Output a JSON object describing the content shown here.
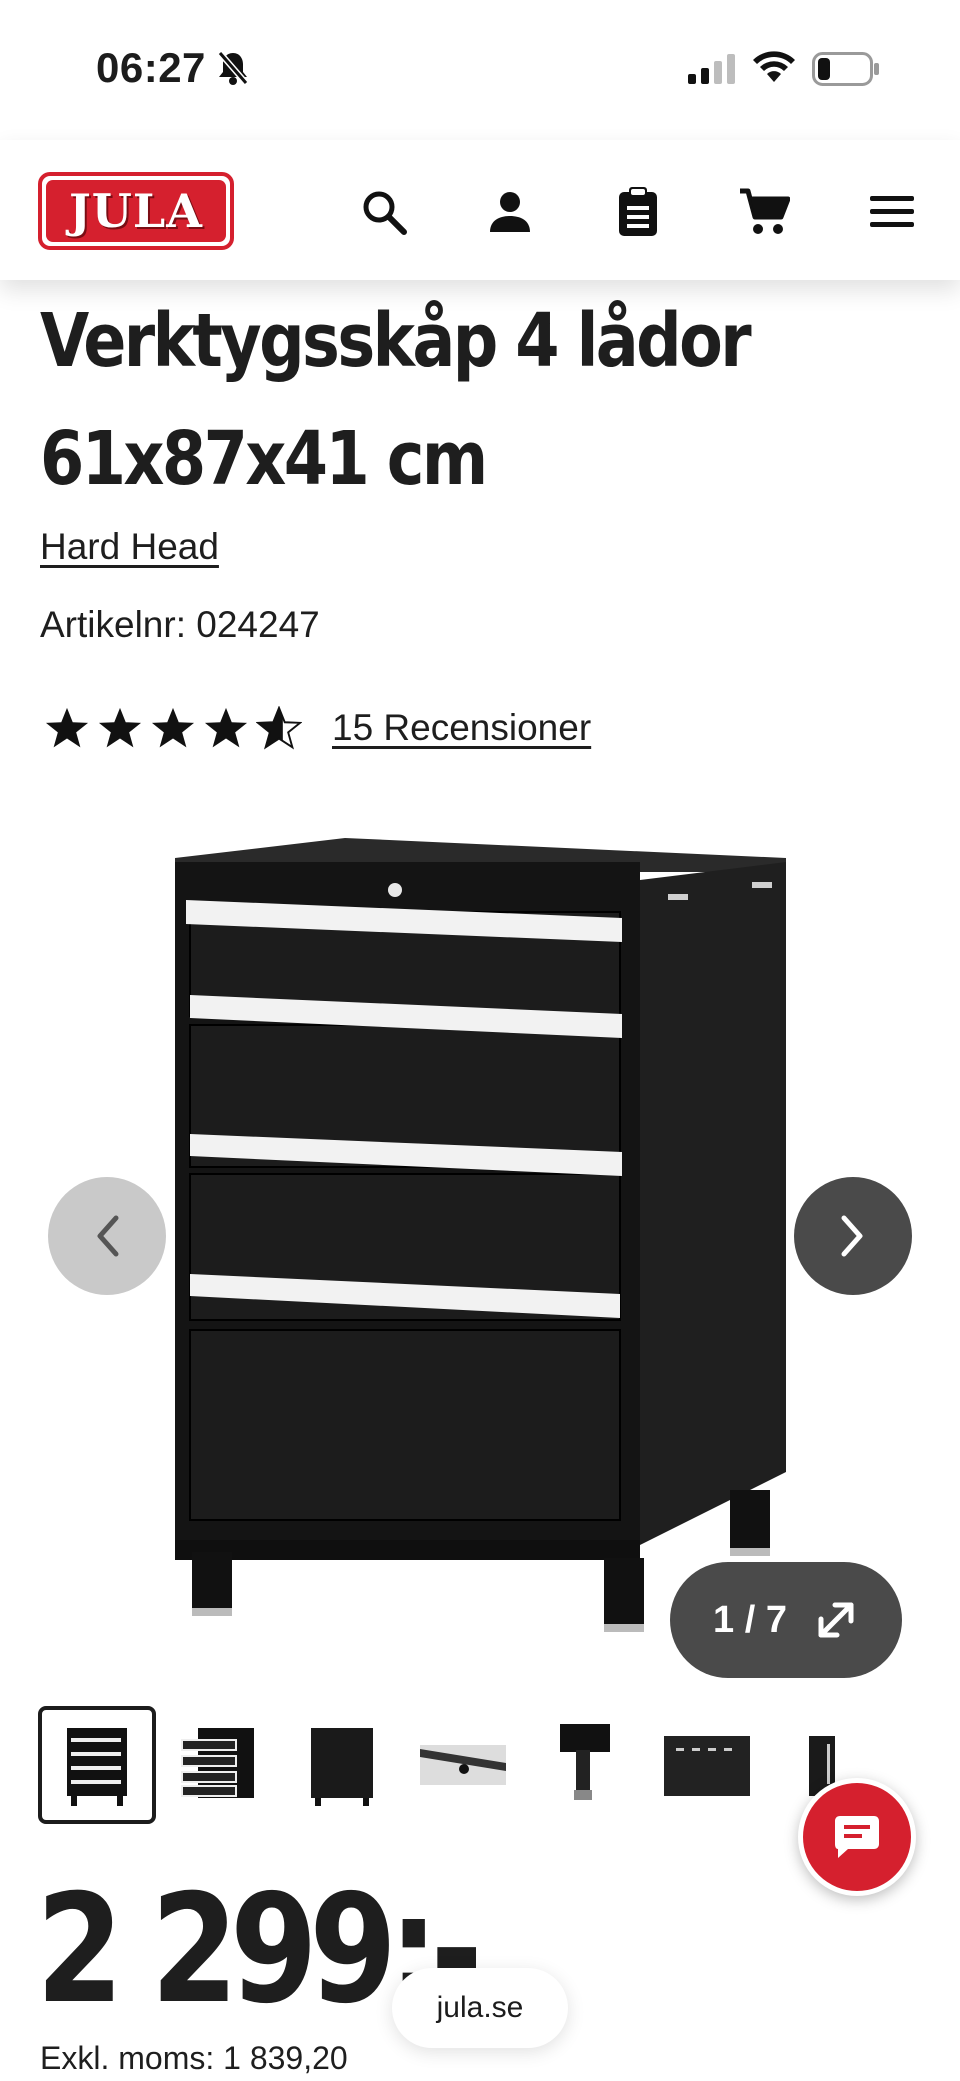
{
  "status_bar": {
    "time": "06:27"
  },
  "header": {
    "logo_text": "JULA",
    "icons": [
      "search-icon",
      "account-icon",
      "list-icon",
      "cart-icon",
      "menu-icon"
    ],
    "brand_color": "#d5202e"
  },
  "product": {
    "title": "Verktygsskåp 4 lådor 61x87x41 cm",
    "brand": "Hard Head",
    "sku_label": "Artikelnr:",
    "sku": "024247",
    "rating": 4.5,
    "rating_max": 5,
    "reviews_label": "15 Recensioner"
  },
  "gallery": {
    "counter": "1 / 7",
    "thumbnail_count": 7,
    "active_index": 0
  },
  "price": {
    "value": "2 299:-",
    "exkl_label": "Exkl. moms:",
    "exkl_value": "1 839,20"
  },
  "browser": {
    "url": "jula.se"
  }
}
